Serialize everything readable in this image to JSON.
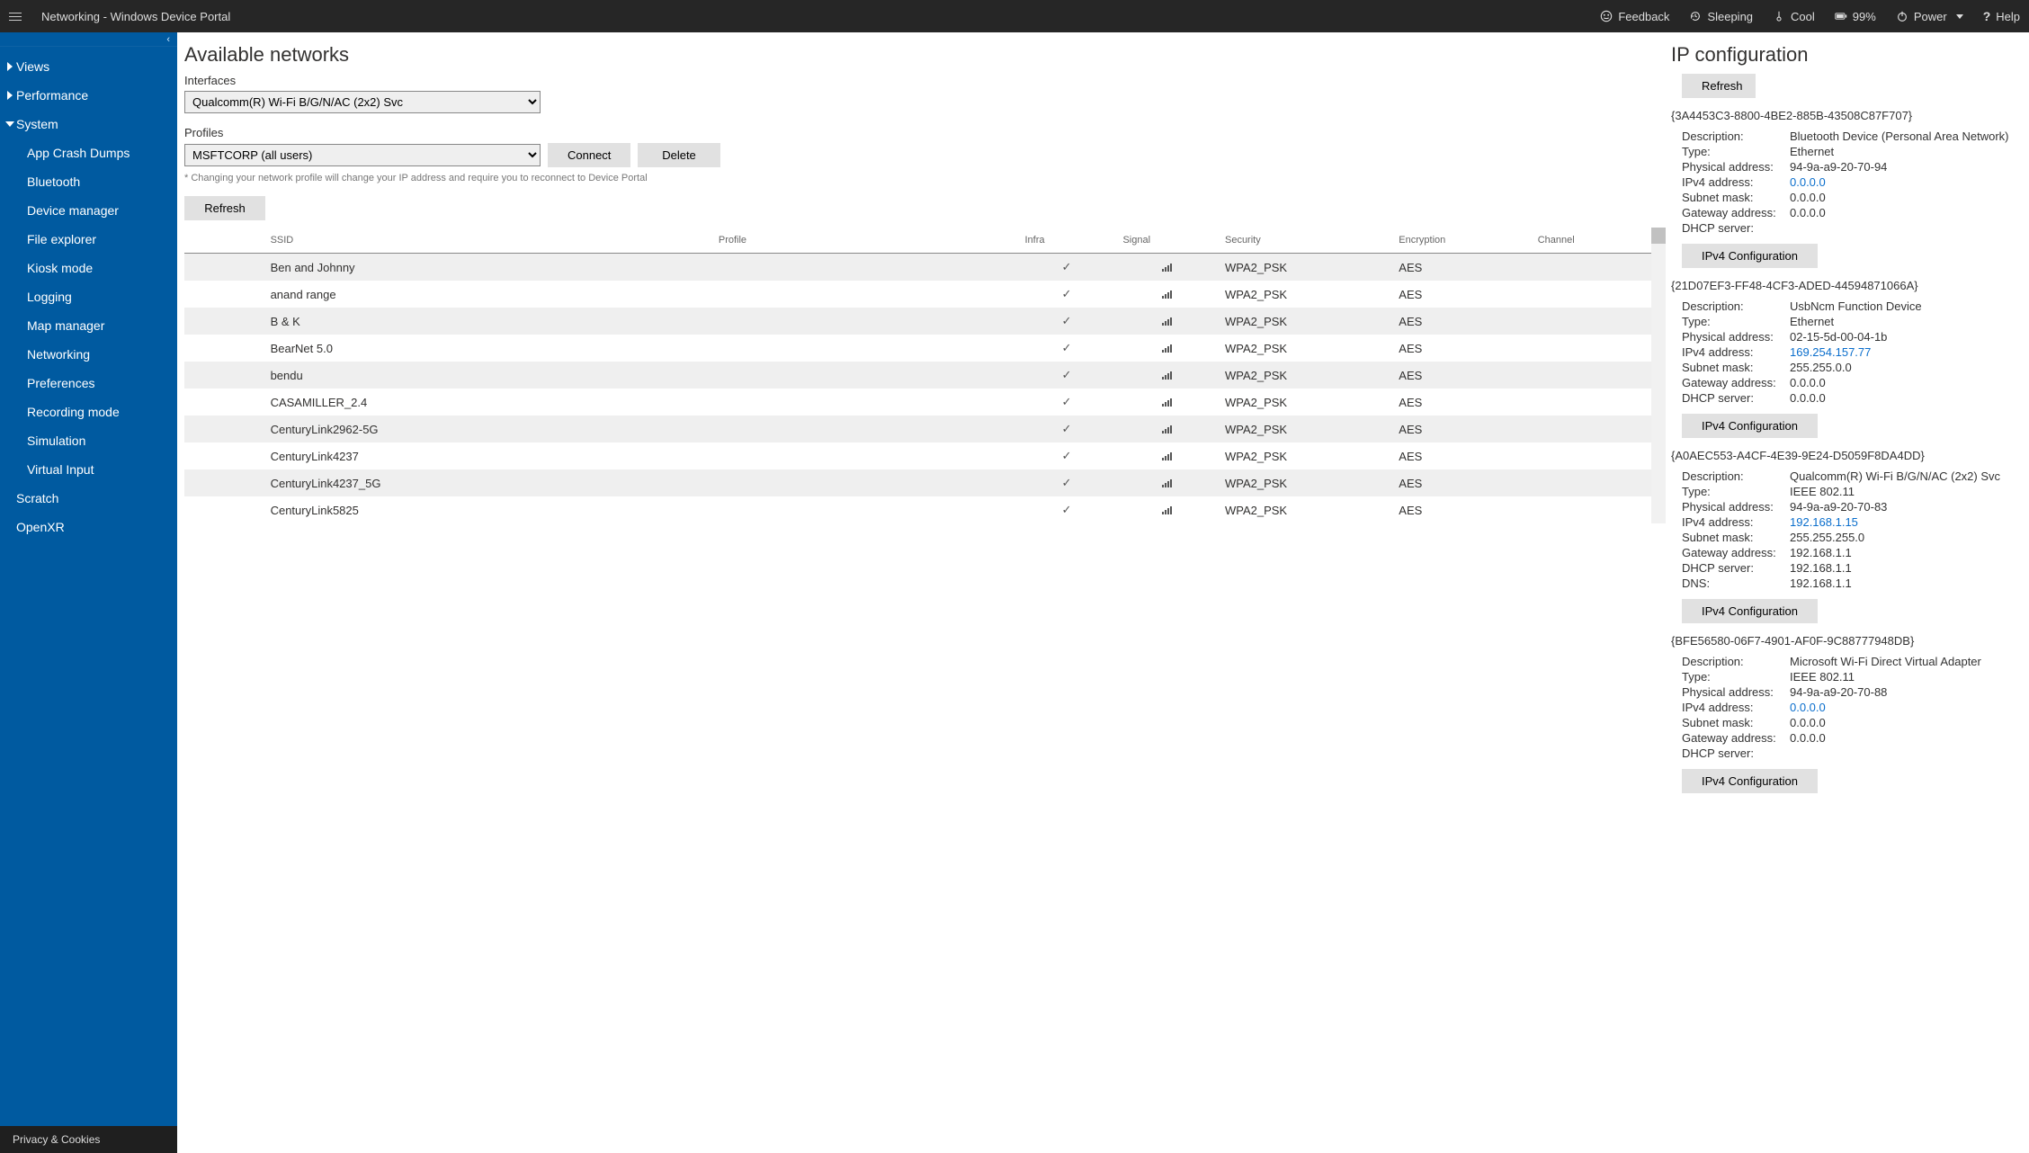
{
  "header": {
    "title": "Networking - Windows Device Portal",
    "feedback_label": "Feedback",
    "sleep_label": "Sleeping",
    "thermal_label": "Cool",
    "battery_label": "99%",
    "power_label": "Power",
    "help_label": "Help"
  },
  "sidebar": {
    "items": [
      {
        "label": "Views",
        "expanded": false,
        "children": []
      },
      {
        "label": "Performance",
        "expanded": false,
        "children": []
      },
      {
        "label": "System",
        "expanded": true,
        "children": [
          "App Crash Dumps",
          "Bluetooth",
          "Device manager",
          "File explorer",
          "Kiosk mode",
          "Logging",
          "Map manager",
          "Networking",
          "Preferences",
          "Recording mode",
          "Simulation",
          "Virtual Input"
        ]
      },
      {
        "label": "Scratch",
        "expanded": false,
        "children": []
      },
      {
        "label": "OpenXR",
        "expanded": false,
        "children": []
      }
    ],
    "footer": "Privacy & Cookies"
  },
  "networks": {
    "heading": "Available networks",
    "interfaces_label": "Interfaces",
    "interfaces_selected": "Qualcomm(R) Wi-Fi B/G/N/AC (2x2) Svc",
    "profiles_label": "Profiles",
    "profiles_selected": "MSFTCORP (all users)",
    "connect_label": "Connect",
    "delete_label": "Delete",
    "hint": "* Changing your network profile will change your IP address and require you to reconnect to Device Portal",
    "refresh_label": "Refresh",
    "columns": [
      "",
      "SSID",
      "Profile",
      "Infra",
      "Signal",
      "Security",
      "Encryption",
      "Channel"
    ],
    "rows": [
      {
        "ssid": "Ben and Johnny",
        "profile": "",
        "infra": true,
        "signal": 4,
        "security": "WPA2_PSK",
        "encryption": "AES",
        "channel": ""
      },
      {
        "ssid": "anand range",
        "profile": "",
        "infra": true,
        "signal": 4,
        "security": "WPA2_PSK",
        "encryption": "AES",
        "channel": ""
      },
      {
        "ssid": "B & K",
        "profile": "",
        "infra": true,
        "signal": 4,
        "security": "WPA2_PSK",
        "encryption": "AES",
        "channel": ""
      },
      {
        "ssid": "BearNet 5.0",
        "profile": "",
        "infra": true,
        "signal": 4,
        "security": "WPA2_PSK",
        "encryption": "AES",
        "channel": ""
      },
      {
        "ssid": "bendu",
        "profile": "",
        "infra": true,
        "signal": 4,
        "security": "WPA2_PSK",
        "encryption": "AES",
        "channel": ""
      },
      {
        "ssid": "CASAMILLER_2.4",
        "profile": "",
        "infra": true,
        "signal": 4,
        "security": "WPA2_PSK",
        "encryption": "AES",
        "channel": ""
      },
      {
        "ssid": "CenturyLink2962-5G",
        "profile": "",
        "infra": true,
        "signal": 4,
        "security": "WPA2_PSK",
        "encryption": "AES",
        "channel": ""
      },
      {
        "ssid": "CenturyLink4237",
        "profile": "",
        "infra": true,
        "signal": 4,
        "security": "WPA2_PSK",
        "encryption": "AES",
        "channel": ""
      },
      {
        "ssid": "CenturyLink4237_5G",
        "profile": "",
        "infra": true,
        "signal": 4,
        "security": "WPA2_PSK",
        "encryption": "AES",
        "channel": ""
      },
      {
        "ssid": "CenturyLink5825",
        "profile": "",
        "infra": true,
        "signal": 4,
        "security": "WPA2_PSK",
        "encryption": "AES",
        "channel": ""
      }
    ]
  },
  "ipconfig": {
    "heading": "IP configuration",
    "refresh_label": "Refresh",
    "ipv4_button_label": "IPv4 Configuration",
    "labels": {
      "description": "Description:",
      "type": "Type:",
      "physical": "Physical address:",
      "ipv4": "IPv4 address:",
      "subnet": "Subnet mask:",
      "gateway": "Gateway address:",
      "dhcp": "DHCP server:",
      "dns": "DNS:"
    },
    "adapters": [
      {
        "guid": "{3A4453C3-8800-4BE2-885B-43508C87F707}",
        "description": "Bluetooth Device (Personal Area Network)",
        "type": "Ethernet",
        "physical": "94-9a-a9-20-70-94",
        "ipv4": "0.0.0.0",
        "subnet": "0.0.0.0",
        "gateway": "0.0.0.0",
        "dhcp": "",
        "dns": null
      },
      {
        "guid": "{21D07EF3-FF48-4CF3-ADED-44594871066A}",
        "description": "UsbNcm Function Device",
        "type": "Ethernet",
        "physical": "02-15-5d-00-04-1b",
        "ipv4": "169.254.157.77",
        "subnet": "255.255.0.0",
        "gateway": "0.0.0.0",
        "dhcp": "0.0.0.0",
        "dns": null
      },
      {
        "guid": "{A0AEC553-A4CF-4E39-9E24-D5059F8DA4DD}",
        "description": "Qualcomm(R) Wi-Fi B/G/N/AC (2x2) Svc",
        "type": "IEEE 802.11",
        "physical": "94-9a-a9-20-70-83",
        "ipv4": "192.168.1.15",
        "subnet": "255.255.255.0",
        "gateway": "192.168.1.1",
        "dhcp": "192.168.1.1",
        "dns": "192.168.1.1"
      },
      {
        "guid": "{BFE56580-06F7-4901-AF0F-9C88777948DB}",
        "description": "Microsoft Wi-Fi Direct Virtual Adapter",
        "type": "IEEE 802.11",
        "physical": "94-9a-a9-20-70-88",
        "ipv4": "0.0.0.0",
        "subnet": "0.0.0.0",
        "gateway": "0.0.0.0",
        "dhcp": "",
        "dns": null
      }
    ]
  }
}
